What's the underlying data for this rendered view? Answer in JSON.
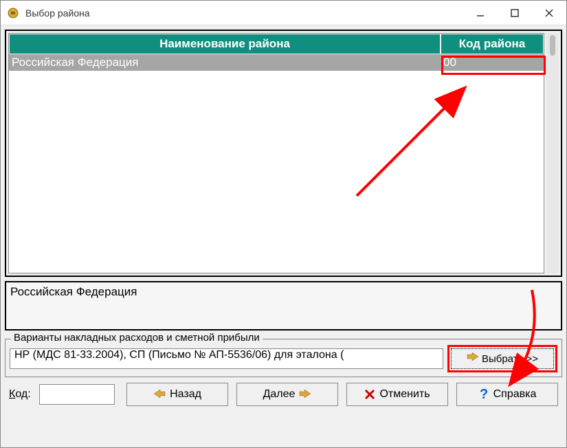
{
  "window": {
    "title": "Выбор района"
  },
  "table": {
    "headers": {
      "name": "Наименование района",
      "code": "Код района"
    },
    "rows": [
      {
        "name": "Российская Федерация",
        "code": "00"
      }
    ]
  },
  "selected": "Российская Федерация",
  "variants": {
    "legend": "Варианты накладных расходов и сметной прибыли",
    "value": "НР (МДС 81-33.2004), СП (Письмо № АП-5536/06) для эталона (",
    "choose": "Выбрать >>"
  },
  "bottom": {
    "code_label": "Код:",
    "code_value": "",
    "back": "Назад",
    "next": "Далее",
    "cancel": "Отменить",
    "help": "Справка"
  }
}
